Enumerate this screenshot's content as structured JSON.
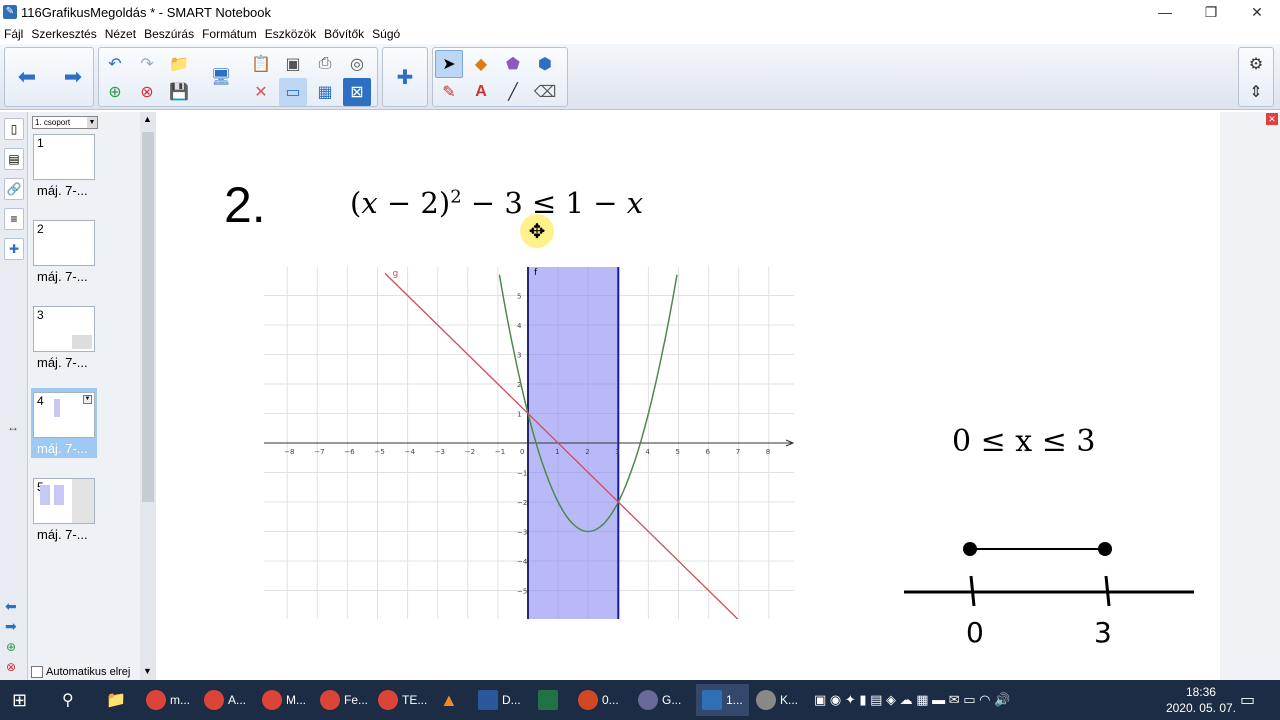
{
  "window": {
    "title": "116GrafikusMegoldás * - SMART Notebook",
    "minimize": "—",
    "maximize": "❐",
    "close": "✕"
  },
  "menu": [
    "Fájl",
    "Szerkesztés",
    "Nézet",
    "Beszúrás",
    "Formátum",
    "Eszközök",
    "Bővítők",
    "Súgó"
  ],
  "sorter": {
    "group": "1. csoport",
    "pages": [
      {
        "num": "1",
        "label": "máj. 7-..."
      },
      {
        "num": "2",
        "label": "máj. 7-..."
      },
      {
        "num": "3",
        "label": "máj. 7-..."
      },
      {
        "num": "4",
        "label": "máj. 7-..."
      },
      {
        "num": "5",
        "label": "máj. 7-..."
      }
    ],
    "auto_hide": "Automatikus elrej"
  },
  "canvas": {
    "problem_number": "2.",
    "equation_parts": [
      "(",
      "x",
      " − 2)",
      "2",
      " − 3 ≤ 1 − ",
      "x"
    ],
    "solution": "0 ≤ x ≤ 3",
    "numberline_labels": [
      "0",
      "3"
    ]
  },
  "graph": {
    "x_ticks": [
      "−8",
      "−7",
      "−6",
      "−5",
      "−4",
      "−3",
      "−2",
      "−1",
      "0",
      "1",
      "2",
      "3",
      "4",
      "5",
      "6",
      "7",
      "8"
    ],
    "y_ticks": [
      "5",
      "4",
      "3",
      "2",
      "1",
      "−1",
      "−2",
      "−3",
      "−4",
      "−5"
    ],
    "label_f": "f",
    "label_g": "g",
    "shade_color": "#8080f0",
    "parabola_color": "#4c8a4c",
    "line_color": "#d04a5a"
  },
  "taskbar": {
    "tasks": [
      {
        "label": "m...",
        "color": "#db4437"
      },
      {
        "label": "A...",
        "color": "#db4437"
      },
      {
        "label": "M...",
        "color": "#db4437"
      },
      {
        "label": "Fe...",
        "color": "#db4437"
      },
      {
        "label": "TE...",
        "color": "#db4437"
      },
      {
        "label": "D...",
        "color": "#2b579a"
      },
      {
        "label": "0...",
        "color": "#d24726"
      },
      {
        "label": "G...",
        "color": "#6a6a9a"
      },
      {
        "label": "1...",
        "color": "#2f6fb6"
      },
      {
        "label": "K...",
        "color": "#888888"
      }
    ],
    "time": "18:36",
    "date": "2020. 05. 07."
  }
}
